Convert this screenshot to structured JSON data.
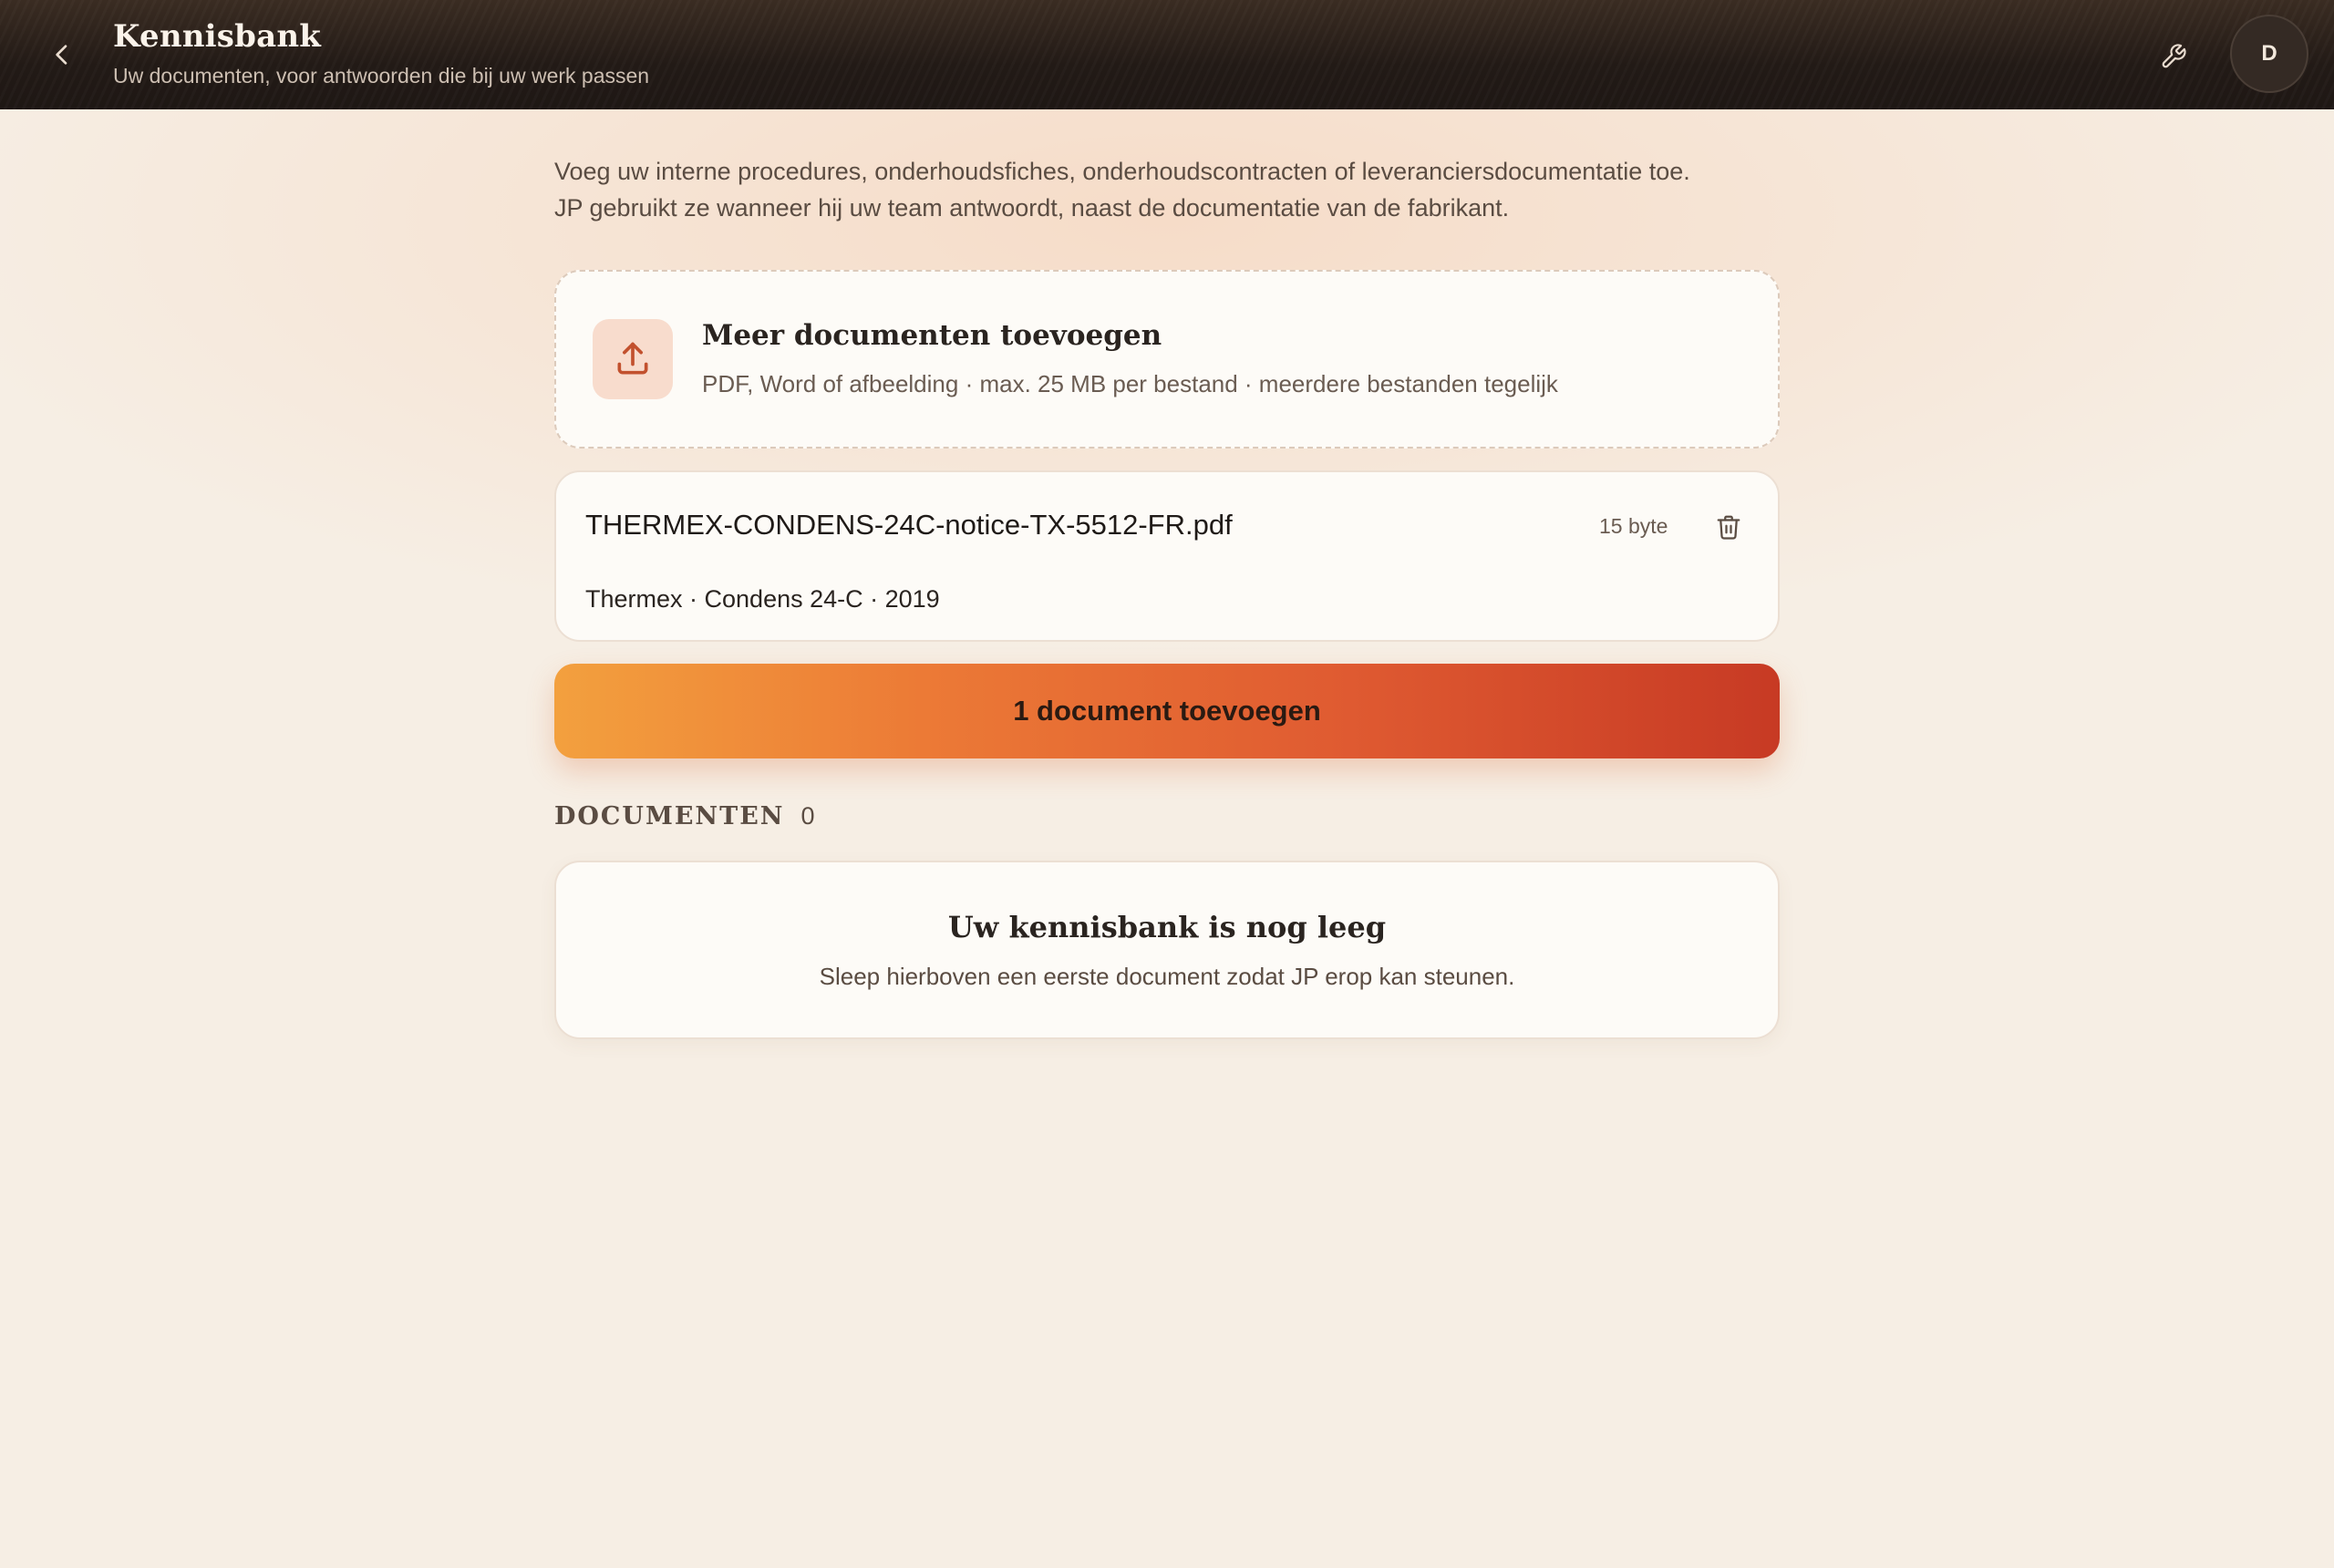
{
  "header": {
    "title": "Kennisbank",
    "subtitle": "Uw documenten, voor antwoorden die bij uw werk passen",
    "avatar_initial": "D",
    "back_icon": "chevron-left-icon",
    "tool_icon": "wrench-icon"
  },
  "intro": {
    "line1": "Voeg uw interne procedures, onderhoudsfiches, onderhoudscontracten of leveranciersdocumentatie toe.",
    "line2": "JP gebruikt ze wanneer hij uw team antwoordt, naast de documentatie van de fabrikant."
  },
  "upload": {
    "title": "Meer documenten toevoegen",
    "hint": "PDF, Word of afbeelding · max. 25 MB per bestand · meerdere bestanden tegelijk",
    "icon": "upload-icon"
  },
  "pending_file": {
    "name": "THERMEX-CONDENS-24C-notice-TX-5512-FR.pdf",
    "size": "15 byte",
    "meta": "Thermex · Condens 24-C · 2019",
    "delete_icon": "trash-icon"
  },
  "add_button": {
    "label": "1 document toevoegen"
  },
  "documents": {
    "label": "DOCUMENTEN",
    "count": "0",
    "empty_title": "Uw kennisbank is nog leeg",
    "empty_hint": "Sleep hierboven een eerste document zodat JP erop kan steunen."
  },
  "colors": {
    "header_bg": "#221a16",
    "accent_start": "#f3a03e",
    "accent_end": "#c73a24",
    "icon_accent": "#c2512e",
    "page_bg": "#f6eee4"
  }
}
